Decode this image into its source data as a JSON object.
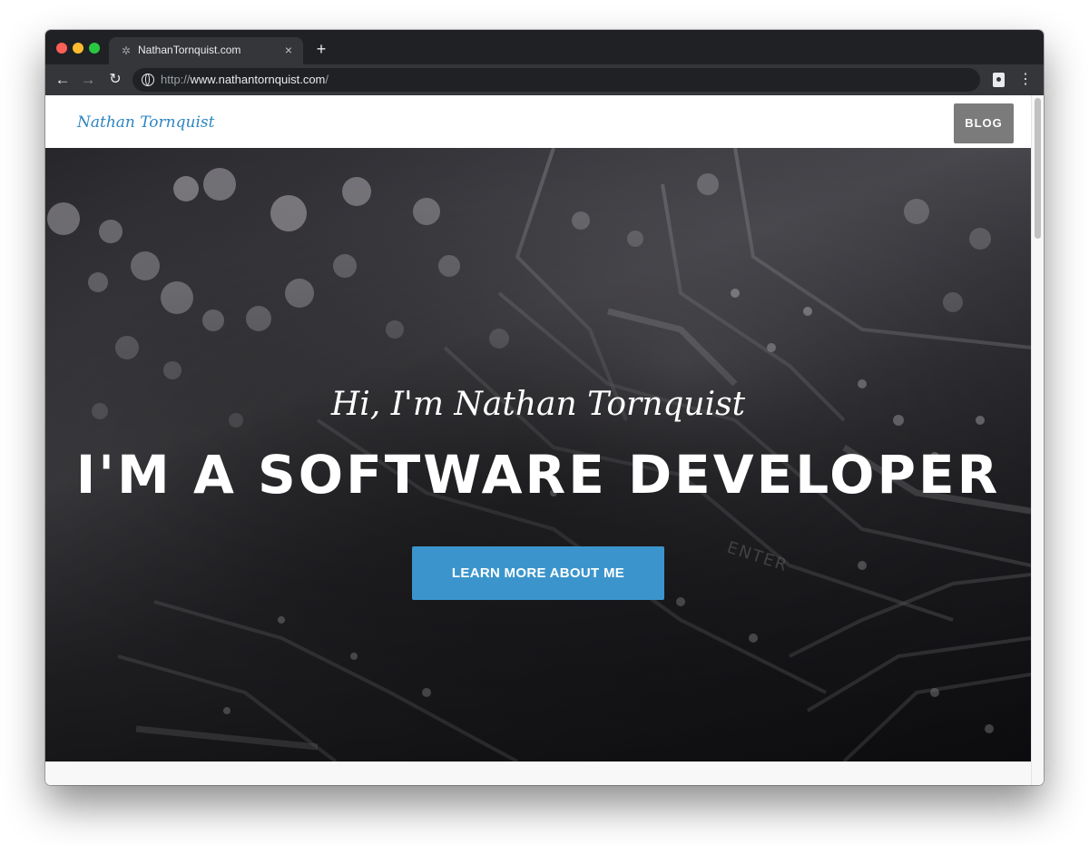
{
  "browser": {
    "tab_title": "NathanTornquist.com",
    "tab_close": "×",
    "new_tab": "+",
    "url_scheme": "http://",
    "url_host": "www.nathantornquist.com",
    "url_path": "/",
    "nav": {
      "back": "←",
      "forward": "→",
      "reload": "↻",
      "menu": "⋮"
    }
  },
  "site": {
    "brand": "Nathan Tornquist",
    "nav_blog": "BLOG"
  },
  "hero": {
    "subtitle": "Hi, I'm Nathan Tornquist",
    "title": "I'M A SOFTWARE DEVELOPER",
    "cta": "LEARN MORE ABOUT ME",
    "background_image": "circuit-board-photo"
  },
  "colors": {
    "brand": "#2f86c1",
    "cta": "#3b95cc",
    "blog_button": "#7b7b7b",
    "browser_chrome": "#35363a"
  }
}
